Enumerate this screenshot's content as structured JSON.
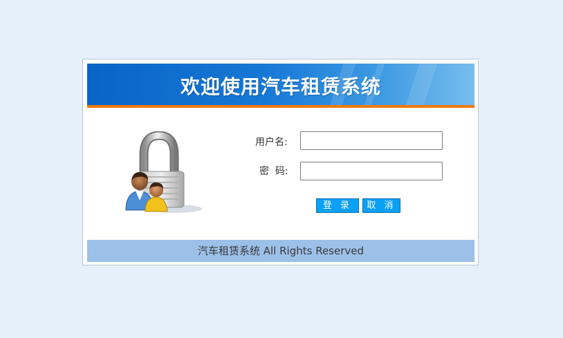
{
  "banner": {
    "title": "欢迎使用汽车租赁系统"
  },
  "form": {
    "username_label": "用户名:",
    "username_value": "",
    "password_label": "密  码:",
    "password_value": "",
    "login_button": "登 录",
    "cancel_button": "取 消"
  },
  "footer": {
    "text": "汽车租赁系统 All Rights Reserved"
  },
  "icons": {
    "login_art": "padlock-users-icon"
  },
  "colors": {
    "page_background": "#e6f0fa",
    "banner_blue": "#1578d6",
    "banner_stripe": "#f07a10",
    "button": "#0aa0f5",
    "footer": "#9cc0e8"
  }
}
